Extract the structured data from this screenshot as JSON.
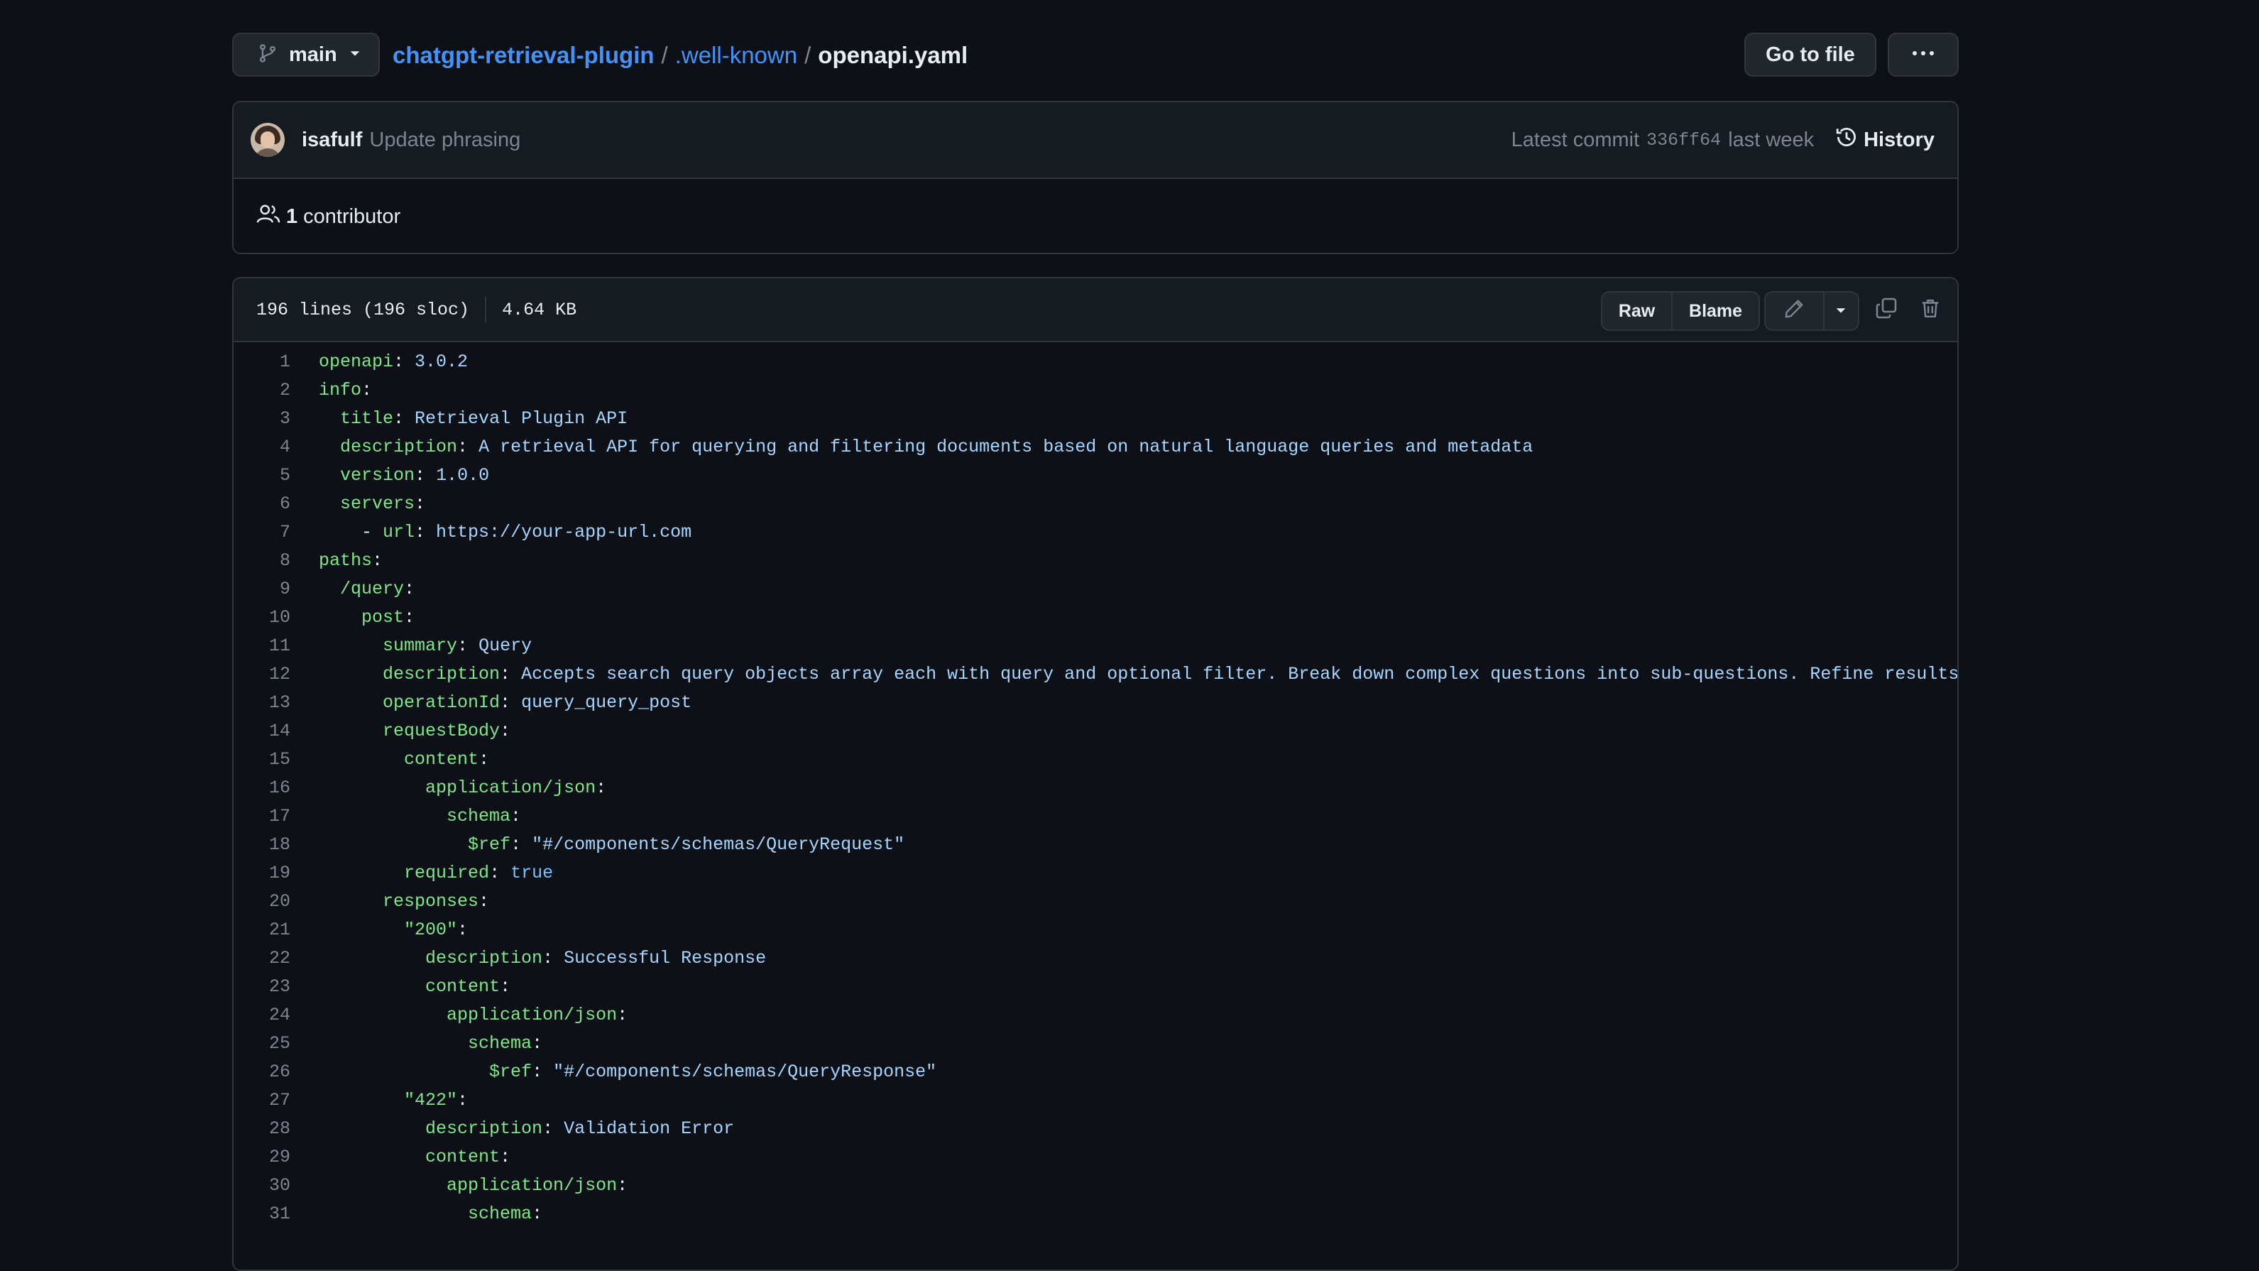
{
  "topbar": {
    "branch": "main",
    "breadcrumb": {
      "repo": "chatgpt-retrieval-plugin",
      "sep1": "/",
      "folder": ".well-known",
      "sep2": "/",
      "file": "openapi.yaml"
    },
    "goto_file": "Go to file",
    "more_icon": "kebab-horizontal-icon"
  },
  "commit": {
    "author": "isafulf",
    "message": "Update phrasing",
    "latest_prefix": "Latest commit",
    "sha": "336ff64",
    "when": "last week",
    "history": "History",
    "contributor_count": "1",
    "contributor_label": "contributor"
  },
  "file": {
    "lines_info": "196 lines (196 sloc)",
    "size": "4.64 KB",
    "raw": "Raw",
    "blame": "Blame"
  },
  "colors": {
    "background": "#0d1117",
    "header_bg": "#161b22",
    "border": "#30363d",
    "link": "#4493f8",
    "yaml_key": "#7ee787",
    "yaml_value": "#a5d6ff",
    "yaml_constant": "#79c0ff",
    "line_number": "#7d8590"
  },
  "code_lines": [
    {
      "n": "1",
      "indent": "",
      "key": "openapi",
      "value": "3.0.2"
    },
    {
      "n": "2",
      "indent": "",
      "key": "info",
      "value": ""
    },
    {
      "n": "3",
      "indent": "  ",
      "key": "title",
      "value": "Retrieval Plugin API"
    },
    {
      "n": "4",
      "indent": "  ",
      "key": "description",
      "value": "A retrieval API for querying and filtering documents based on natural language queries and metadata"
    },
    {
      "n": "5",
      "indent": "  ",
      "key": "version",
      "value": "1.0.0"
    },
    {
      "n": "6",
      "indent": "  ",
      "key": "servers",
      "value": ""
    },
    {
      "n": "7",
      "indent": "    - ",
      "key": "url",
      "value": "https://your-app-url.com"
    },
    {
      "n": "8",
      "indent": "",
      "key": "paths",
      "value": ""
    },
    {
      "n": "9",
      "indent": "  ",
      "key": "/query",
      "value": ""
    },
    {
      "n": "10",
      "indent": "    ",
      "key": "post",
      "value": ""
    },
    {
      "n": "11",
      "indent": "      ",
      "key": "summary",
      "value": "Query"
    },
    {
      "n": "12",
      "indent": "      ",
      "key": "description",
      "value": "Accepts search query objects array each with query and optional filter. Break down complex questions into sub-questions. Refine results by criteria, e.g. time / source, don't do this often. Split queries if ResponseTooLargeError occurs."
    },
    {
      "n": "13",
      "indent": "      ",
      "key": "operationId",
      "value": "query_query_post"
    },
    {
      "n": "14",
      "indent": "      ",
      "key": "requestBody",
      "value": ""
    },
    {
      "n": "15",
      "indent": "        ",
      "key": "content",
      "value": ""
    },
    {
      "n": "16",
      "indent": "          ",
      "key": "application/json",
      "value": ""
    },
    {
      "n": "17",
      "indent": "            ",
      "key": "schema",
      "value": ""
    },
    {
      "n": "18",
      "indent": "              ",
      "key": "$ref",
      "value": "\"#/components/schemas/QueryRequest\""
    },
    {
      "n": "19",
      "indent": "        ",
      "key": "required",
      "value": "true",
      "const": true
    },
    {
      "n": "20",
      "indent": "      ",
      "key": "responses",
      "value": ""
    },
    {
      "n": "21",
      "indent": "        ",
      "key": "\"200\"",
      "value": ""
    },
    {
      "n": "22",
      "indent": "          ",
      "key": "description",
      "value": "Successful Response"
    },
    {
      "n": "23",
      "indent": "          ",
      "key": "content",
      "value": ""
    },
    {
      "n": "24",
      "indent": "            ",
      "key": "application/json",
      "value": ""
    },
    {
      "n": "25",
      "indent": "              ",
      "key": "schema",
      "value": ""
    },
    {
      "n": "26",
      "indent": "                ",
      "key": "$ref",
      "value": "\"#/components/schemas/QueryResponse\""
    },
    {
      "n": "27",
      "indent": "        ",
      "key": "\"422\"",
      "value": ""
    },
    {
      "n": "28",
      "indent": "          ",
      "key": "description",
      "value": "Validation Error"
    },
    {
      "n": "29",
      "indent": "          ",
      "key": "content",
      "value": ""
    },
    {
      "n": "30",
      "indent": "            ",
      "key": "application/json",
      "value": ""
    },
    {
      "n": "31",
      "indent": "              ",
      "key": "schema",
      "value": ""
    }
  ]
}
